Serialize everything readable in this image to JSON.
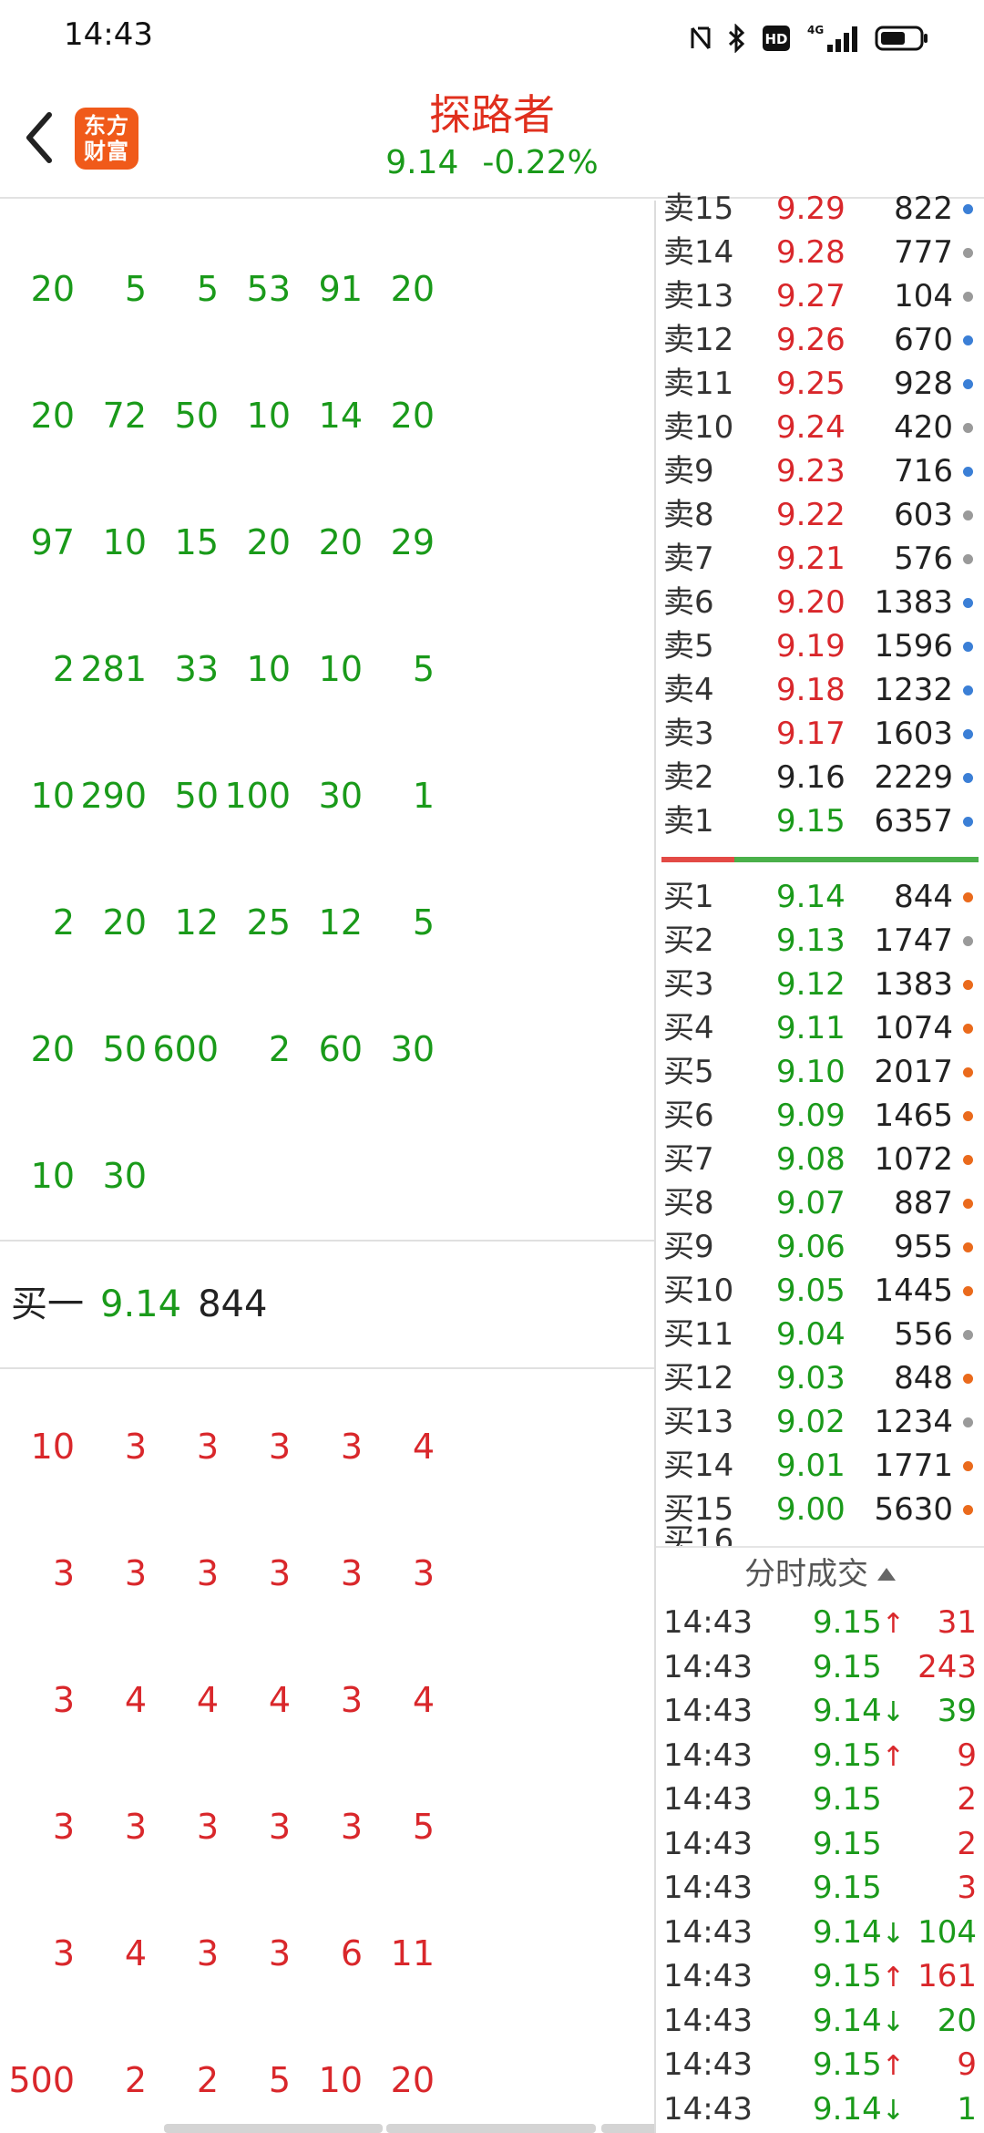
{
  "status_bar": {
    "time": "14:43",
    "icons": [
      "nfc-icon",
      "bluetooth-icon",
      "hd-icon",
      "signal-4g-icon",
      "battery-icon"
    ]
  },
  "header": {
    "stock_name": "探路者",
    "price": "9.14",
    "change_pct": "-0.22%",
    "logo_line1": "东方",
    "logo_line2": "财富"
  },
  "sell_queue": {
    "color": "#1a9a1a",
    "rows": [
      [
        "20",
        "5",
        "5",
        "53",
        "91",
        "20"
      ],
      [
        "20",
        "72",
        "50",
        "10",
        "14",
        "20"
      ],
      [
        "97",
        "10",
        "15",
        "20",
        "20",
        "29"
      ],
      [
        "2",
        "281",
        "33",
        "10",
        "10",
        "5"
      ],
      [
        "10",
        "290",
        "50",
        "100",
        "30",
        "1"
      ],
      [
        "2",
        "20",
        "12",
        "25",
        "12",
        "5"
      ],
      [
        "20",
        "50",
        "600",
        "2",
        "60",
        "30"
      ],
      [
        "10",
        "30"
      ]
    ]
  },
  "buy1_bar": {
    "label": "买一",
    "price": "9.14",
    "volume": "844"
  },
  "buy_queue": {
    "color": "#d9272b",
    "rows": [
      [
        "10",
        "3",
        "3",
        "3",
        "3",
        "4"
      ],
      [
        "3",
        "3",
        "3",
        "3",
        "3",
        "3"
      ],
      [
        "3",
        "4",
        "4",
        "4",
        "3",
        "4"
      ],
      [
        "3",
        "3",
        "3",
        "3",
        "3",
        "5"
      ],
      [
        "3",
        "4",
        "3",
        "3",
        "6",
        "11"
      ],
      [
        "500",
        "2",
        "2",
        "5",
        "10",
        "20"
      ]
    ]
  },
  "order_book": {
    "asks": [
      {
        "label": "卖15",
        "price": "9.29",
        "volume": "822",
        "price_color": "red",
        "dot": "blue"
      },
      {
        "label": "卖14",
        "price": "9.28",
        "volume": "777",
        "price_color": "red",
        "dot": "gray"
      },
      {
        "label": "卖13",
        "price": "9.27",
        "volume": "104",
        "price_color": "red",
        "dot": "gray"
      },
      {
        "label": "卖12",
        "price": "9.26",
        "volume": "670",
        "price_color": "red",
        "dot": "blue"
      },
      {
        "label": "卖11",
        "price": "9.25",
        "volume": "928",
        "price_color": "red",
        "dot": "blue"
      },
      {
        "label": "卖10",
        "price": "9.24",
        "volume": "420",
        "price_color": "red",
        "dot": "gray"
      },
      {
        "label": "卖9",
        "price": "9.23",
        "volume": "716",
        "price_color": "red",
        "dot": "blue"
      },
      {
        "label": "卖8",
        "price": "9.22",
        "volume": "603",
        "price_color": "red",
        "dot": "gray"
      },
      {
        "label": "卖7",
        "price": "9.21",
        "volume": "576",
        "price_color": "red",
        "dot": "gray"
      },
      {
        "label": "卖6",
        "price": "9.20",
        "volume": "1383",
        "price_color": "red",
        "dot": "blue"
      },
      {
        "label": "卖5",
        "price": "9.19",
        "volume": "1596",
        "price_color": "red",
        "dot": "blue"
      },
      {
        "label": "卖4",
        "price": "9.18",
        "volume": "1232",
        "price_color": "red",
        "dot": "blue"
      },
      {
        "label": "卖3",
        "price": "9.17",
        "volume": "1603",
        "price_color": "red",
        "dot": "blue"
      },
      {
        "label": "卖2",
        "price": "9.16",
        "volume": "2229",
        "price_color": "gray",
        "dot": "blue"
      },
      {
        "label": "卖1",
        "price": "9.15",
        "volume": "6357",
        "price_color": "green",
        "dot": "blue"
      }
    ],
    "bids": [
      {
        "label": "买1",
        "price": "9.14",
        "volume": "844",
        "price_color": "green",
        "dot": "orange"
      },
      {
        "label": "买2",
        "price": "9.13",
        "volume": "1747",
        "price_color": "green",
        "dot": "gray"
      },
      {
        "label": "买3",
        "price": "9.12",
        "volume": "1383",
        "price_color": "green",
        "dot": "orange"
      },
      {
        "label": "买4",
        "price": "9.11",
        "volume": "1074",
        "price_color": "green",
        "dot": "orange"
      },
      {
        "label": "买5",
        "price": "9.10",
        "volume": "2017",
        "price_color": "green",
        "dot": "orange"
      },
      {
        "label": "买6",
        "price": "9.09",
        "volume": "1465",
        "price_color": "green",
        "dot": "orange"
      },
      {
        "label": "买7",
        "price": "9.08",
        "volume": "1072",
        "price_color": "green",
        "dot": "orange"
      },
      {
        "label": "买8",
        "price": "9.07",
        "volume": "887",
        "price_color": "green",
        "dot": "orange"
      },
      {
        "label": "买9",
        "price": "9.06",
        "volume": "955",
        "price_color": "green",
        "dot": "orange"
      },
      {
        "label": "买10",
        "price": "9.05",
        "volume": "1445",
        "price_color": "green",
        "dot": "orange"
      },
      {
        "label": "买11",
        "price": "9.04",
        "volume": "556",
        "price_color": "green",
        "dot": "gray"
      },
      {
        "label": "买12",
        "price": "9.03",
        "volume": "848",
        "price_color": "green",
        "dot": "orange"
      },
      {
        "label": "买13",
        "price": "9.02",
        "volume": "1234",
        "price_color": "green",
        "dot": "gray"
      },
      {
        "label": "买14",
        "price": "9.01",
        "volume": "1771",
        "price_color": "green",
        "dot": "orange"
      },
      {
        "label": "买15",
        "price": "9.00",
        "volume": "5630",
        "price_color": "green",
        "dot": "orange"
      }
    ],
    "buy_sell_ratio": 0.23
  },
  "tick_trades": {
    "title": "分时成交",
    "rows": [
      {
        "time": "14:43",
        "price": "9.15",
        "arrow": "↑",
        "dir": "up",
        "volume": "31",
        "vol_color": "red"
      },
      {
        "time": "14:43",
        "price": "9.15",
        "arrow": "",
        "dir": "",
        "volume": "243",
        "vol_color": "red"
      },
      {
        "time": "14:43",
        "price": "9.14",
        "arrow": "↓",
        "dir": "down",
        "volume": "39",
        "vol_color": "green"
      },
      {
        "time": "14:43",
        "price": "9.15",
        "arrow": "↑",
        "dir": "up",
        "volume": "9",
        "vol_color": "red"
      },
      {
        "time": "14:43",
        "price": "9.15",
        "arrow": "",
        "dir": "",
        "volume": "2",
        "vol_color": "red"
      },
      {
        "time": "14:43",
        "price": "9.15",
        "arrow": "",
        "dir": "",
        "volume": "2",
        "vol_color": "red"
      },
      {
        "time": "14:43",
        "price": "9.15",
        "arrow": "",
        "dir": "",
        "volume": "3",
        "vol_color": "red"
      },
      {
        "time": "14:43",
        "price": "9.14",
        "arrow": "↓",
        "dir": "down",
        "volume": "104",
        "vol_color": "green"
      },
      {
        "time": "14:43",
        "price": "9.15",
        "arrow": "↑",
        "dir": "up",
        "volume": "161",
        "vol_color": "red"
      },
      {
        "time": "14:43",
        "price": "9.14",
        "arrow": "↓",
        "dir": "down",
        "volume": "20",
        "vol_color": "green"
      },
      {
        "time": "14:43",
        "price": "9.15",
        "arrow": "↑",
        "dir": "up",
        "volume": "9",
        "vol_color": "red"
      },
      {
        "time": "14:43",
        "price": "9.14",
        "arrow": "↓",
        "dir": "down",
        "volume": "1",
        "vol_color": "green"
      }
    ]
  }
}
